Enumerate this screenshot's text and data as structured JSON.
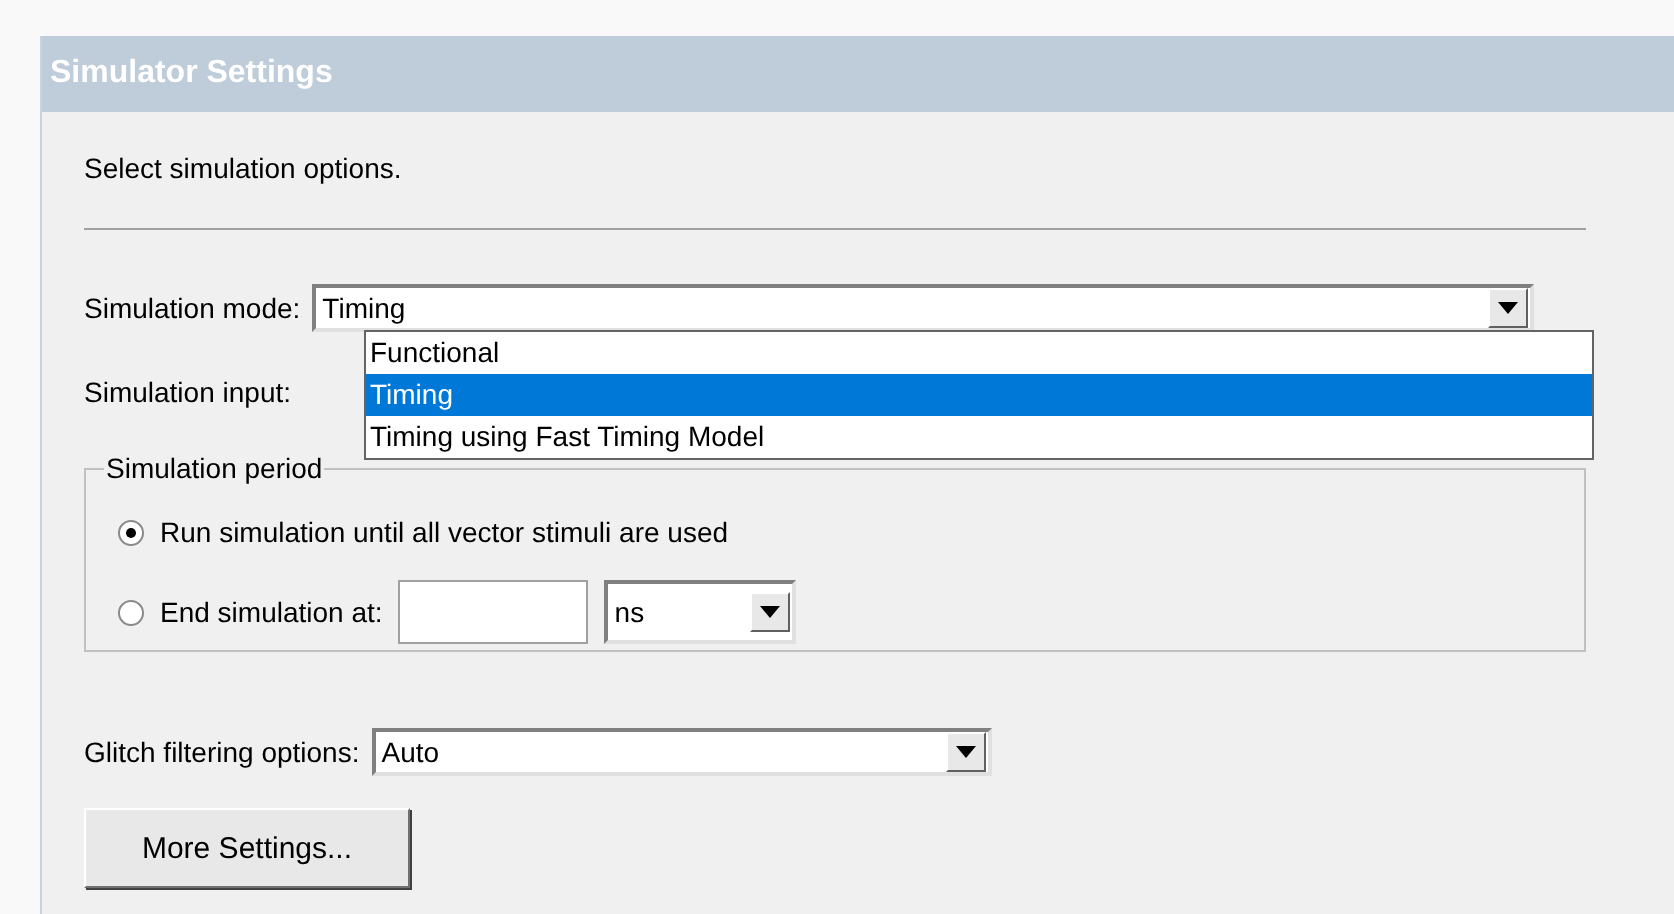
{
  "panel": {
    "title": "Simulator Settings"
  },
  "instruction": "Select simulation options.",
  "simulation_mode": {
    "label": "Simulation mode:",
    "value": "Timing",
    "expanded": true,
    "options": [
      {
        "label": "Functional",
        "selected": false
      },
      {
        "label": "Timing",
        "selected": true
      },
      {
        "label": "Timing using Fast Timing Model",
        "selected": false
      }
    ]
  },
  "simulation_input": {
    "label": "Simulation input:"
  },
  "simulation_period": {
    "title": "Simulation period",
    "options": [
      {
        "label": "Run simulation until all vector stimuli are used",
        "selected": true
      },
      {
        "label": "End simulation at:",
        "selected": false
      }
    ],
    "unit": {
      "value": "ns"
    }
  },
  "glitch_filtering": {
    "label": "Glitch filtering options:",
    "value": "Auto"
  },
  "buttons": [
    "More Settings..."
  ]
}
